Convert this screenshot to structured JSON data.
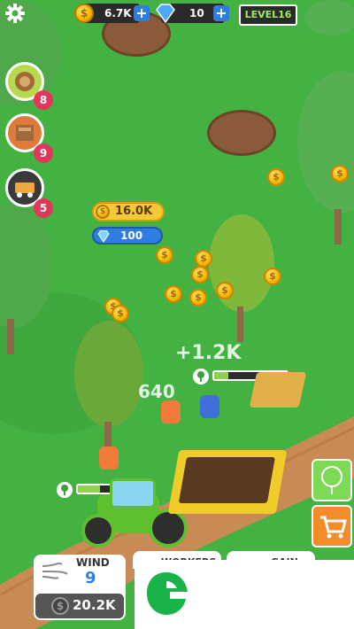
{
  "hud": {
    "coins": "6.7K",
    "gems": "10",
    "level": "LEVEL16"
  },
  "side_buttons": [
    {
      "name": "timber-order-button",
      "badge": "8"
    },
    {
      "name": "crate-order-button",
      "badge": "9"
    },
    {
      "name": "truck-order-button",
      "badge": "5"
    }
  ],
  "floating": {
    "coin_reward": "16.0K",
    "gem_reward": "100",
    "gain_popup": "+1.2K",
    "count_popup": "640"
  },
  "progress": {
    "tree_progress": 0.2,
    "tractor_progress": 0.3
  },
  "bottom": {
    "wind_label": "WIND",
    "wind_value": "9",
    "wind_cost": "20.2K",
    "workers_label": "WORKERS",
    "gain_label": "GAIN"
  },
  "colors": {
    "grass": "#43b243",
    "path": "#c98a55",
    "accent_green": "#7ed957",
    "shop_orange": "#f28c28"
  }
}
